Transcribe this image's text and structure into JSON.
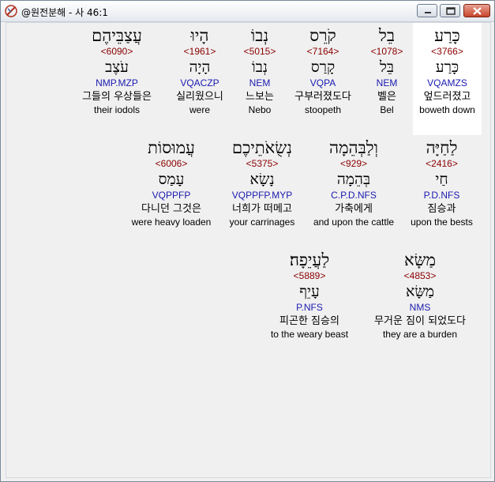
{
  "window": {
    "title": "@원전분해 - 사 46:1",
    "app_icon": "app-logo-icon",
    "controls": {
      "minimize_icon": "minimize-icon",
      "maximize_icon": "maximize-icon",
      "close_icon": "close-icon"
    }
  },
  "rows": [
    {
      "words": [
        {
          "hebrew": "כָּרַע",
          "strong": "<3766>",
          "lemma": "כָּרַע",
          "parse": "VQAMZS",
          "korean": "엎드러졌고",
          "english": "boweth down",
          "selected": true
        },
        {
          "hebrew": "בֵל",
          "strong": "<1078>",
          "lemma": "בֵּל",
          "parse": "NEM",
          "korean": "벨은",
          "english": "Bel"
        },
        {
          "hebrew": "קֹרֵס",
          "strong": "<7164>",
          "lemma": "קָרַס",
          "parse": "VQPA",
          "korean": "구부러졌도다",
          "english": "stoopeth"
        },
        {
          "hebrew": "נְבוֹ",
          "strong": "<5015>",
          "lemma": "נְבוֹ",
          "parse": "NEM",
          "korean": "느보는",
          "english": "Nebo"
        },
        {
          "hebrew": "הָיוּ",
          "strong": "<1961>",
          "lemma": "הָיָה",
          "parse": "VQACZP",
          "korean": "실리웠으니",
          "english": "were"
        },
        {
          "hebrew": "עֲצַבֵּיהֶם",
          "strong": "<6090>",
          "lemma": "עֹצֶב",
          "parse": "NMP.MZP",
          "korean": "그들의 우상들은",
          "english": "their iodols"
        }
      ]
    },
    {
      "words": [
        {
          "hebrew": "לַחַיָּה",
          "strong": "<2416>",
          "lemma": "חַי",
          "parse": "P.D.NFS",
          "korean": "짐승과",
          "english": "upon the bests"
        },
        {
          "hebrew": "וְלַבְּהֵמָה",
          "strong": "<929>",
          "lemma": "בְּהֵמָה",
          "parse": "C.P.D.NFS",
          "korean": "가축에게",
          "english": "and upon the cattle"
        },
        {
          "hebrew": "נְשֻׂאֹתֵיכֶם",
          "strong": "<5375>",
          "lemma": "נָשָׂא",
          "parse": "VQPPFP.MYP",
          "korean": "너희가 떠메고",
          "english": "your carrinages"
        },
        {
          "hebrew": "עֲמוּסוֹת",
          "strong": "<6006>",
          "lemma": "עָמַס",
          "parse": "VQPPFP",
          "korean": "다니던 그것은",
          "english": "were heavy loaden"
        }
      ]
    },
    {
      "words": [
        {
          "hebrew": "מַשָּׂא",
          "strong": "<4853>",
          "lemma": "מַשָּׂא",
          "parse": "NMS",
          "korean": "무거운 짐이 되었도다",
          "english": "they are a burden"
        },
        {
          "hebrew": "לַעֲיֵפָה׃",
          "strong": "<5889>",
          "lemma": "עָיֵף",
          "parse": "P.NFS",
          "korean": "피곤한 짐승의",
          "english": "to the weary beast"
        }
      ]
    }
  ],
  "colors": {
    "strong": "#8b0000",
    "parse": "#1a1ab0",
    "selected_bg": "#ffffff"
  }
}
